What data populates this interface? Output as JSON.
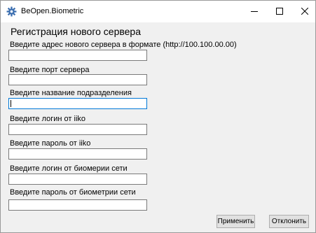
{
  "window": {
    "title": "BeOpen.Biometric",
    "app_icon": "gear-icon",
    "controls": {
      "minimize_icon": "minimize-icon",
      "maximize_icon": "maximize-icon",
      "close_icon": "close-icon"
    }
  },
  "form": {
    "heading": "Регистрация нового сервера",
    "fields": [
      {
        "label": "Введите адрес нового сервера в формате (http://100.100.00.00)",
        "value": ""
      },
      {
        "label": "Введите порт сервера",
        "value": ""
      },
      {
        "label": "Введите название подразделения",
        "value": ""
      },
      {
        "label": "Введите логин от iiko",
        "value": ""
      },
      {
        "label": "Введите пароль от iiko",
        "value": ""
      },
      {
        "label": "Введите логин от биомерии сети",
        "value": ""
      },
      {
        "label": "Введите пароль от биометрии сети",
        "value": ""
      }
    ]
  },
  "buttons": {
    "apply_label": "Применить",
    "cancel_label": "Отклонить"
  },
  "colors": {
    "focus_border": "#0078d7",
    "window_background": "#f0f0f0",
    "titlebar_background": "#ffffff"
  }
}
